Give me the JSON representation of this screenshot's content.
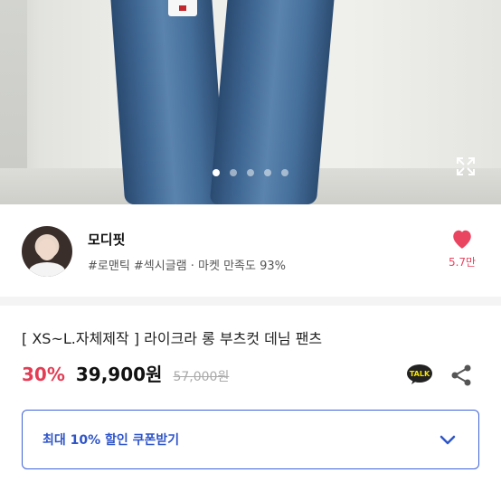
{
  "hero": {
    "dots": [
      true,
      false,
      false,
      false,
      false
    ]
  },
  "seller": {
    "name": "모디핏",
    "meta": "#로맨틱 #섹시글램 · 마켓 만족도 93%",
    "likes": "5.7만"
  },
  "product": {
    "title": "[ XS~L.자체제작 ] 라이크라 롱 부츠컷 데님 팬츠",
    "discount": "30%",
    "price": "39,900원",
    "original_price": "57,000원",
    "share_icon": "share-icon",
    "talk_icon": "kakao-talk-icon"
  },
  "coupon": {
    "label": "최대 10% 할인 쿠폰받기"
  },
  "colors": {
    "accent": "#e33d55",
    "coupon_blue": "#2f55c9"
  }
}
